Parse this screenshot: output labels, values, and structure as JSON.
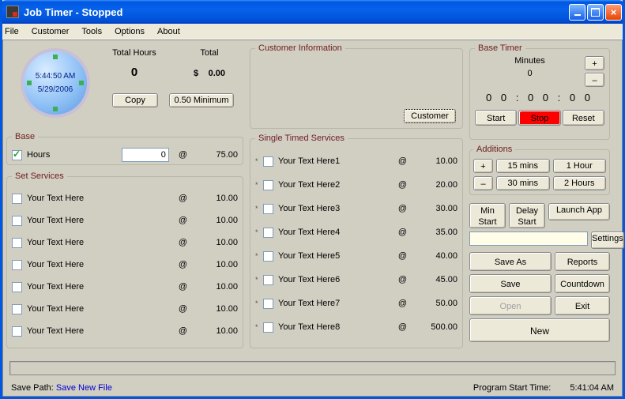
{
  "window": {
    "title": "Job Timer - Stopped"
  },
  "menu": {
    "file": "File",
    "customer": "Customer",
    "tools": "Tools",
    "options": "Options",
    "about": "About"
  },
  "clock": {
    "time": "5:44:50 AM",
    "date": "5/29/2006"
  },
  "totals": {
    "hours_label": "Total Hours",
    "hours_value": "0",
    "total_label": "Total",
    "currency": "$",
    "total_value": "0.00",
    "copy": "Copy",
    "minimum": "0.50 Minimum"
  },
  "customer": {
    "title": "Customer Information",
    "button": "Customer"
  },
  "base": {
    "title": "Base",
    "hours_label": "Hours",
    "hours_value": "0",
    "at": "@",
    "rate": "75.00"
  },
  "set_services": {
    "title": "Set Services",
    "rows": [
      {
        "label": "Your Text Here",
        "at": "@",
        "amt": "10.00"
      },
      {
        "label": "Your Text Here",
        "at": "@",
        "amt": "10.00"
      },
      {
        "label": "Your Text Here",
        "at": "@",
        "amt": "10.00"
      },
      {
        "label": "Your Text Here",
        "at": "@",
        "amt": "10.00"
      },
      {
        "label": "Your Text Here",
        "at": "@",
        "amt": "10.00"
      },
      {
        "label": "Your Text Here",
        "at": "@",
        "amt": "10.00"
      },
      {
        "label": "Your Text Here",
        "at": "@",
        "amt": "10.00"
      }
    ]
  },
  "single_timed": {
    "title": "Single Timed Services",
    "rows": [
      {
        "label": "Your Text Here1",
        "at": "@",
        "amt": "10.00"
      },
      {
        "label": "Your Text Here2",
        "at": "@",
        "amt": "20.00"
      },
      {
        "label": "Your Text Here3",
        "at": "@",
        "amt": "30.00"
      },
      {
        "label": "Your Text Here4",
        "at": "@",
        "amt": "35.00"
      },
      {
        "label": "Your Text Here5",
        "at": "@",
        "amt": "40.00"
      },
      {
        "label": "Your Text Here6",
        "at": "@",
        "amt": "45.00"
      },
      {
        "label": "Your Text Here7",
        "at": "@",
        "amt": "50.00"
      },
      {
        "label": "Your Text Here8",
        "at": "@",
        "amt": "500.00"
      }
    ]
  },
  "base_timer": {
    "title": "Base Timer",
    "minutes_label": "Minutes",
    "minutes_value": "0",
    "digits": "0 0 : 0 0 : 0 0",
    "plus": "+",
    "minus": "–",
    "start": "Start",
    "stop": "Stop",
    "reset": "Reset"
  },
  "additions": {
    "title": "Additions",
    "plus": "+",
    "minus": "–",
    "m15": "15 mins",
    "m30": "30 mins",
    "h1": "1 Hour",
    "h2": "2 Hours"
  },
  "right_buttons": {
    "min_start": "Min\nStart",
    "delay_start": "Delay\nStart",
    "launch_app": "Launch App",
    "settings": "Settings",
    "save_as": "Save As",
    "reports": "Reports",
    "save": "Save",
    "countdown": "Countdown",
    "open": "Open",
    "exit": "Exit",
    "new": "New"
  },
  "footer": {
    "save_path_label": "Save Path:",
    "save_link": "Save New File",
    "prog_start_label": "Program Start Time:",
    "prog_start_time": "5:41:04 AM"
  }
}
